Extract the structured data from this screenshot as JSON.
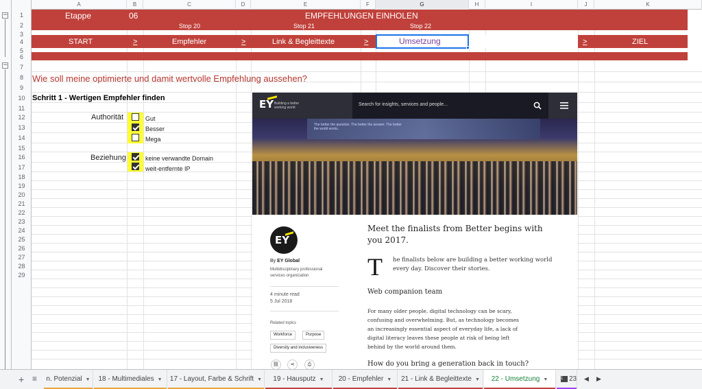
{
  "columns": [
    "A",
    "B",
    "C",
    "D",
    "E",
    "F",
    "G",
    "H",
    "I",
    "J",
    "K"
  ],
  "selected_column": "G",
  "rows": [
    "1",
    "2",
    "3",
    "4",
    "5",
    "6",
    "7",
    "8",
    "9",
    "10",
    "11",
    "12",
    "13",
    "14",
    "15",
    "16",
    "17",
    "18",
    "19",
    "20",
    "21",
    "22",
    "23",
    "24",
    "25",
    "26",
    "27",
    "28",
    "29"
  ],
  "group_toggles": [
    "−",
    "−"
  ],
  "header": {
    "etappe_label": "Etappe",
    "etappe_number": "06",
    "section_title": "EMPFEHLUNGEN EINHOLEN",
    "stops": [
      "Stop 20",
      "Stop 21",
      "Stop 22"
    ]
  },
  "progress_row": {
    "start": "START",
    "sep": ">",
    "step1": "Empfehler",
    "step2": "Link & Begleittexte",
    "current": "Umsetzung",
    "goal": "ZIEL"
  },
  "content": {
    "question": "Wie soll meine optimierte und damit wertvolle Empfehlung aussehen?",
    "step_heading": "Schritt 1 - Wertigen Empfehler finden",
    "authority_label": "Authorität",
    "authority_options": [
      {
        "label": "Gut",
        "checked": false
      },
      {
        "label": "Besser",
        "checked": true
      },
      {
        "label": "Mega",
        "checked": false
      }
    ],
    "relation_label": "Beziehung",
    "relation_options": [
      {
        "label": "keine verwandte Domain",
        "checked": true
      },
      {
        "label": "weit-entfernte IP",
        "checked": true
      }
    ]
  },
  "embedded": {
    "logo": "EY",
    "tagline": "Building a better working world",
    "search_placeholder": "Search for insights, services and people...",
    "photo_caption": "The better the question. The better the answer. The better the world works.",
    "author_by": "By",
    "author_name": "EY Global",
    "author_desc": "Multidisciplinary professional services organization",
    "read_time": "4 minute read",
    "date": "5 Jul 2018",
    "related_label": "Related topics",
    "topics": [
      "Workforce",
      "Purpose",
      "Diversity and inclusiveness"
    ],
    "title": "Meet the finalists from Better begins with you 2017.",
    "dropcap": "T",
    "lead": "he finalists below are building a better working world every day. Discover their stories.",
    "subhead": "Web companion team",
    "body": "For many older people, digital technology can be scary, confusing and overwhelming. But, as technology becomes an increasingly essential aspect of everyday life, a lack of digital literacy leaves these people at risk of being left behind by the world around them.",
    "subhead2": "How do you bring a generation back in touch?"
  },
  "tabs": [
    {
      "label": "n. Potenzial",
      "color": "#e8a33d"
    },
    {
      "label": "18 - Multimediales",
      "color": "#e8a33d"
    },
    {
      "label": "17 - Layout, Farbe & Schrift",
      "color": "#e8a33d"
    },
    {
      "label": "19 - Hausputz",
      "color": "#c0413b"
    },
    {
      "label": "20 - Empfehler",
      "color": "#c0413b"
    },
    {
      "label": "21 - Link & Begleittexte",
      "color": "#c0413b"
    },
    {
      "label": "22 - Umsetzung",
      "color": "#c0413b",
      "active": true
    },
    {
      "label": "23",
      "color": "#a142f4"
    }
  ],
  "colors": {
    "band": "#c0413b",
    "highlight": "#ffff33",
    "selection": "#1a73e8",
    "active_tab_text": "#188038"
  }
}
